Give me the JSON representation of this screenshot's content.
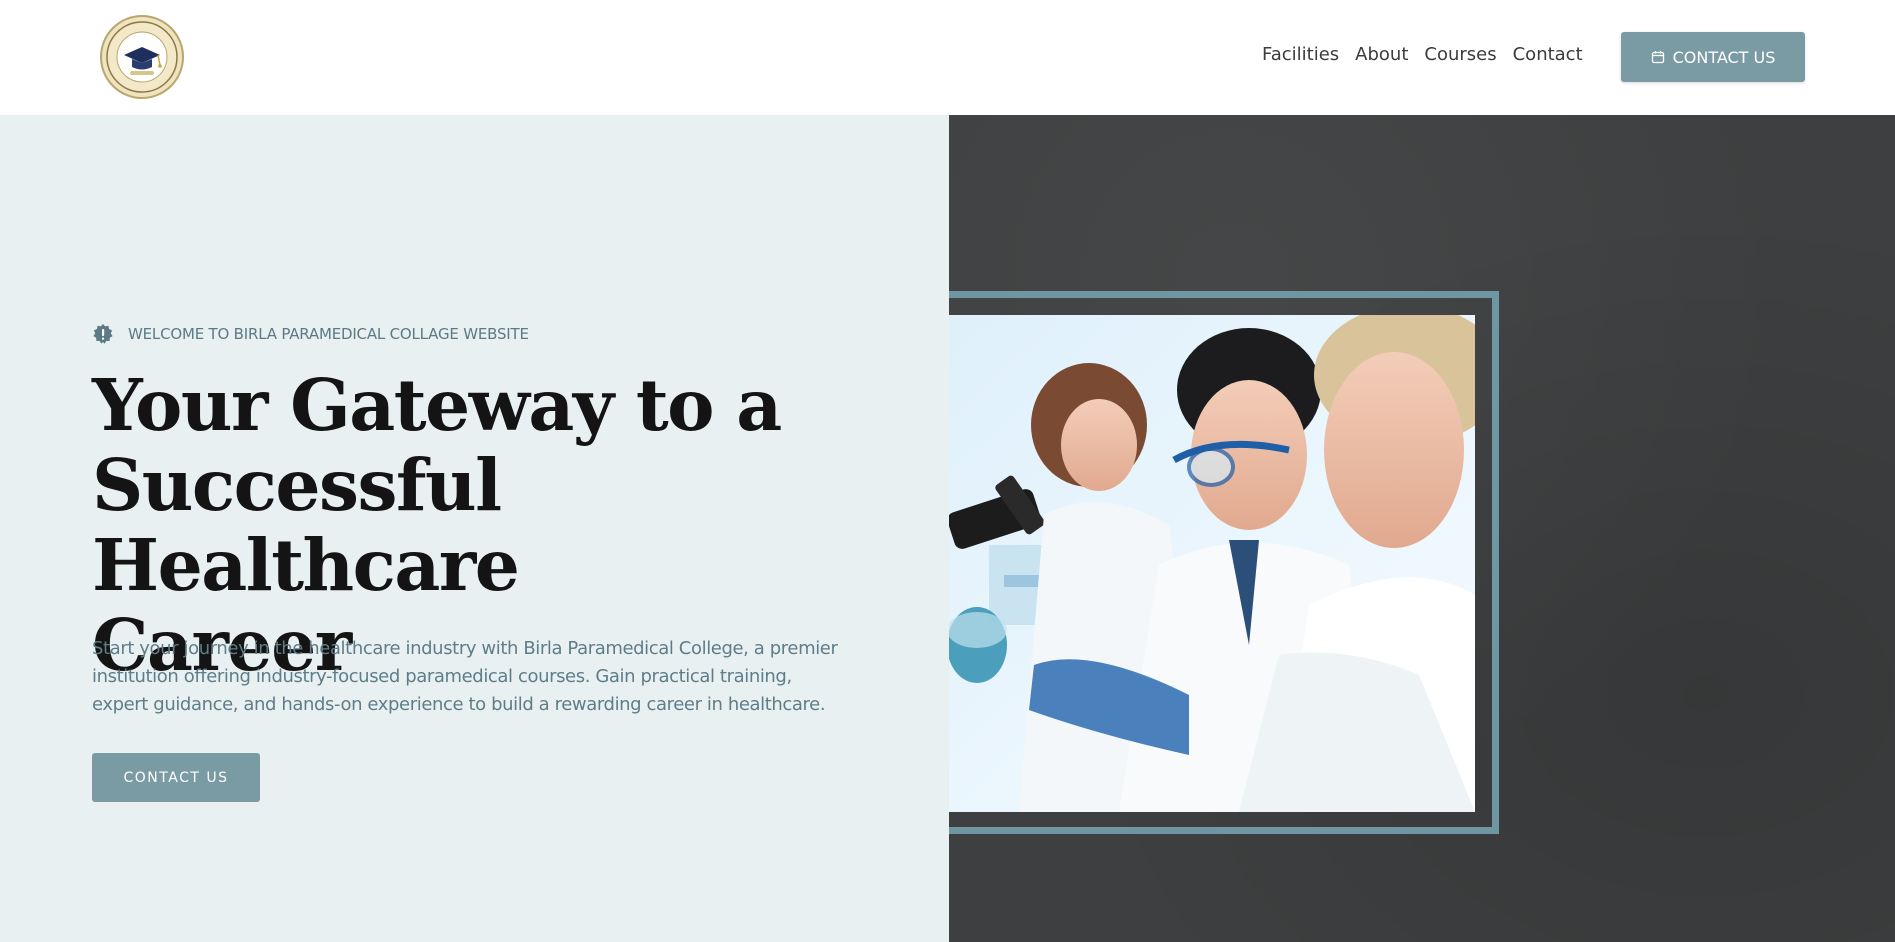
{
  "header": {
    "logo_alt": "Birla Paramedical College Delhi",
    "nav": [
      {
        "label": "Facilities"
      },
      {
        "label": "About"
      },
      {
        "label": "Courses"
      },
      {
        "label": "Contact"
      }
    ],
    "cta_label": "CONTACT US",
    "cta_icon": "calendar-icon"
  },
  "hero": {
    "welcome_text": "WELCOME TO BIRLA PARAMEDICAL COLLAGE WEBSITE",
    "headline_lines": [
      "Your Gateway to a",
      "Successful Healthcare",
      "Career"
    ],
    "description": "Start your journey in the healthcare industry with Birla Paramedical College, a premier institution offering industry-focused paramedical courses. Gain practical training, expert guidance, and hands-on experience to build a rewarding career in healthcare.",
    "cta_label": "CONTACT US",
    "image_alt": "Medical students working with microscope and lab glassware"
  },
  "colors": {
    "accent": "#7b9ba4",
    "hero_bg": "#e9f0f2",
    "dark_bg": "#3d3f40",
    "frame": "#6f97a3",
    "heading": "#141414",
    "body_text": "#5f7d88"
  }
}
